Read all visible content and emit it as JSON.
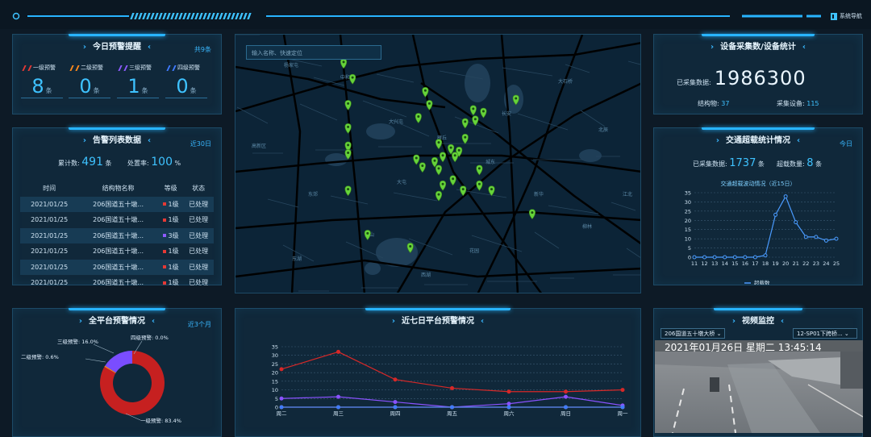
{
  "nav": {
    "label": "系统导航"
  },
  "today_alerts": {
    "title": "今日预警提醒",
    "tag": "共9条",
    "levels": [
      {
        "label": "一级预警",
        "value": "8",
        "unit": "条",
        "color": "#e53935"
      },
      {
        "label": "二级预警",
        "value": "0",
        "unit": "条",
        "color": "#ff8a1c"
      },
      {
        "label": "三级预警",
        "value": "1",
        "unit": "条",
        "color": "#8e5bff"
      },
      {
        "label": "四级预警",
        "value": "0",
        "unit": "条",
        "color": "#3f7bff"
      }
    ]
  },
  "alert_list": {
    "title": "告警列表数据",
    "tag": "近30日",
    "total_label": "累计数:",
    "total_value": "491",
    "total_unit": "条",
    "rate_label": "处置率:",
    "rate_value": "100",
    "rate_unit": "%",
    "columns": [
      "时间",
      "结构物名称",
      "等级",
      "状态"
    ],
    "rows": [
      {
        "time": "2021/01/25",
        "name": "206国道五十墩...",
        "level": "1级",
        "status": "已处理",
        "color": "#e53935"
      },
      {
        "time": "2021/01/25",
        "name": "206国道五十墩...",
        "level": "1级",
        "status": "已处理",
        "color": "#e53935"
      },
      {
        "time": "2021/01/25",
        "name": "206国道五十墩...",
        "level": "3级",
        "status": "已处理",
        "color": "#8e5bff"
      },
      {
        "time": "2021/01/25",
        "name": "206国道五十墩...",
        "level": "1级",
        "status": "已处理",
        "color": "#e53935"
      },
      {
        "time": "2021/01/25",
        "name": "206国道五十墩...",
        "level": "1级",
        "status": "已处理",
        "color": "#e53935"
      },
      {
        "time": "2021/01/25",
        "name": "206国道五十墩...",
        "level": "1级",
        "status": "已处理",
        "color": "#e53935"
      }
    ]
  },
  "platform_alerts": {
    "title": "全平台预警情况",
    "tag": "近3个月",
    "slices": [
      {
        "label": "一级预警: 83.4%",
        "value": 83.4,
        "color": "#c62020"
      },
      {
        "label": "二级预警: 0.6%",
        "value": 0.6,
        "color": "#ff8a1c"
      },
      {
        "label": "三级预警: 16.0%",
        "value": 16.0,
        "color": "#7a4dff"
      },
      {
        "label": "四级预警: 0.0%",
        "value": 0.0,
        "color": "#3f7bff"
      }
    ]
  },
  "map": {
    "search_placeholder": "输入名称、快速定位",
    "labels": [
      "杨家屯",
      "中和",
      "大兴屯",
      "雁丘",
      "城东",
      "新华",
      "柳林",
      "东郊",
      "南山",
      "西湖",
      "花园",
      "北辰",
      "高新区",
      "大石桥",
      "长安",
      "东湖",
      "江北",
      "大屯"
    ],
    "markers": [
      [
        0.266,
        0.13
      ],
      [
        0.288,
        0.19
      ],
      [
        0.277,
        0.29
      ],
      [
        0.277,
        0.38
      ],
      [
        0.277,
        0.45
      ],
      [
        0.277,
        0.48
      ],
      [
        0.277,
        0.62
      ],
      [
        0.467,
        0.24
      ],
      [
        0.477,
        0.29
      ],
      [
        0.45,
        0.34
      ],
      [
        0.5,
        0.44
      ],
      [
        0.53,
        0.46
      ],
      [
        0.51,
        0.49
      ],
      [
        0.49,
        0.51
      ],
      [
        0.5,
        0.54
      ],
      [
        0.55,
        0.47
      ],
      [
        0.565,
        0.42
      ],
      [
        0.54,
        0.49
      ],
      [
        0.46,
        0.53
      ],
      [
        0.445,
        0.5
      ],
      [
        0.6,
        0.54
      ],
      [
        0.61,
        0.32
      ],
      [
        0.59,
        0.35
      ],
      [
        0.56,
        0.62
      ],
      [
        0.6,
        0.6
      ],
      [
        0.63,
        0.62
      ],
      [
        0.5,
        0.64
      ],
      [
        0.51,
        0.6
      ],
      [
        0.69,
        0.27
      ],
      [
        0.73,
        0.71
      ],
      [
        0.325,
        0.79
      ],
      [
        0.43,
        0.84
      ],
      [
        0.565,
        0.36
      ],
      [
        0.585,
        0.31
      ],
      [
        0.535,
        0.58
      ]
    ]
  },
  "collection": {
    "title": "设备采集数/设备统计",
    "collected_label": "已采集数据:",
    "collected_value": "1986300",
    "struct_label": "结构物:",
    "struct_value": "37",
    "device_label": "采集设备:",
    "device_value": "115"
  },
  "overload": {
    "title": "交通超载统计情况",
    "tag": "今日",
    "collected_label": "已采集数据:",
    "collected_value": "1737",
    "collected_unit": "条",
    "over_label": "超载数量:",
    "over_value": "8",
    "over_unit": "条",
    "chart_title": "交通超载波动情况（近15日）",
    "legend": "超载数"
  },
  "weekly": {
    "title": "近七日平台预警情况"
  },
  "video": {
    "title": "视频监控",
    "select_left": "206国道五十墩大桥",
    "select_right": "12-SP01下跨桥...",
    "overlay": "2021年01月26日 星期二 13:45:14"
  },
  "chart_data": [
    {
      "type": "line",
      "x": [
        "11",
        "12",
        "13",
        "14",
        "15",
        "16",
        "17",
        "18",
        "19",
        "20",
        "21",
        "22",
        "23",
        "24",
        "25"
      ],
      "series": [
        {
          "name": "超载数",
          "values": [
            0,
            0,
            0,
            0,
            0,
            0,
            0,
            1,
            23,
            33,
            19,
            11,
            11,
            9,
            10
          ],
          "color": "#4a9bff"
        }
      ],
      "ylim": [
        0,
        35
      ],
      "yticks": [
        0,
        5,
        10,
        15,
        20,
        25,
        30,
        35
      ],
      "grid": true
    },
    {
      "type": "line",
      "x": [
        "周二",
        "周三",
        "周四",
        "周五",
        "周六",
        "周日",
        "周一"
      ],
      "series": [
        {
          "values": [
            22,
            32,
            16,
            11,
            9,
            9,
            10
          ],
          "color": "#d62828"
        },
        {
          "values": [
            5,
            6,
            3,
            0,
            2,
            6,
            1
          ],
          "color": "#8a52ff"
        },
        {
          "values": [
            0,
            0,
            0,
            0,
            0,
            0,
            0
          ],
          "color": "#ffa030"
        },
        {
          "values": [
            0,
            0,
            0,
            0,
            0,
            0,
            0
          ],
          "color": "#3f7bff"
        }
      ],
      "ylim": [
        0,
        35
      ],
      "yticks": [
        0,
        5,
        10,
        15,
        20,
        25,
        30,
        35
      ],
      "grid": true
    }
  ]
}
